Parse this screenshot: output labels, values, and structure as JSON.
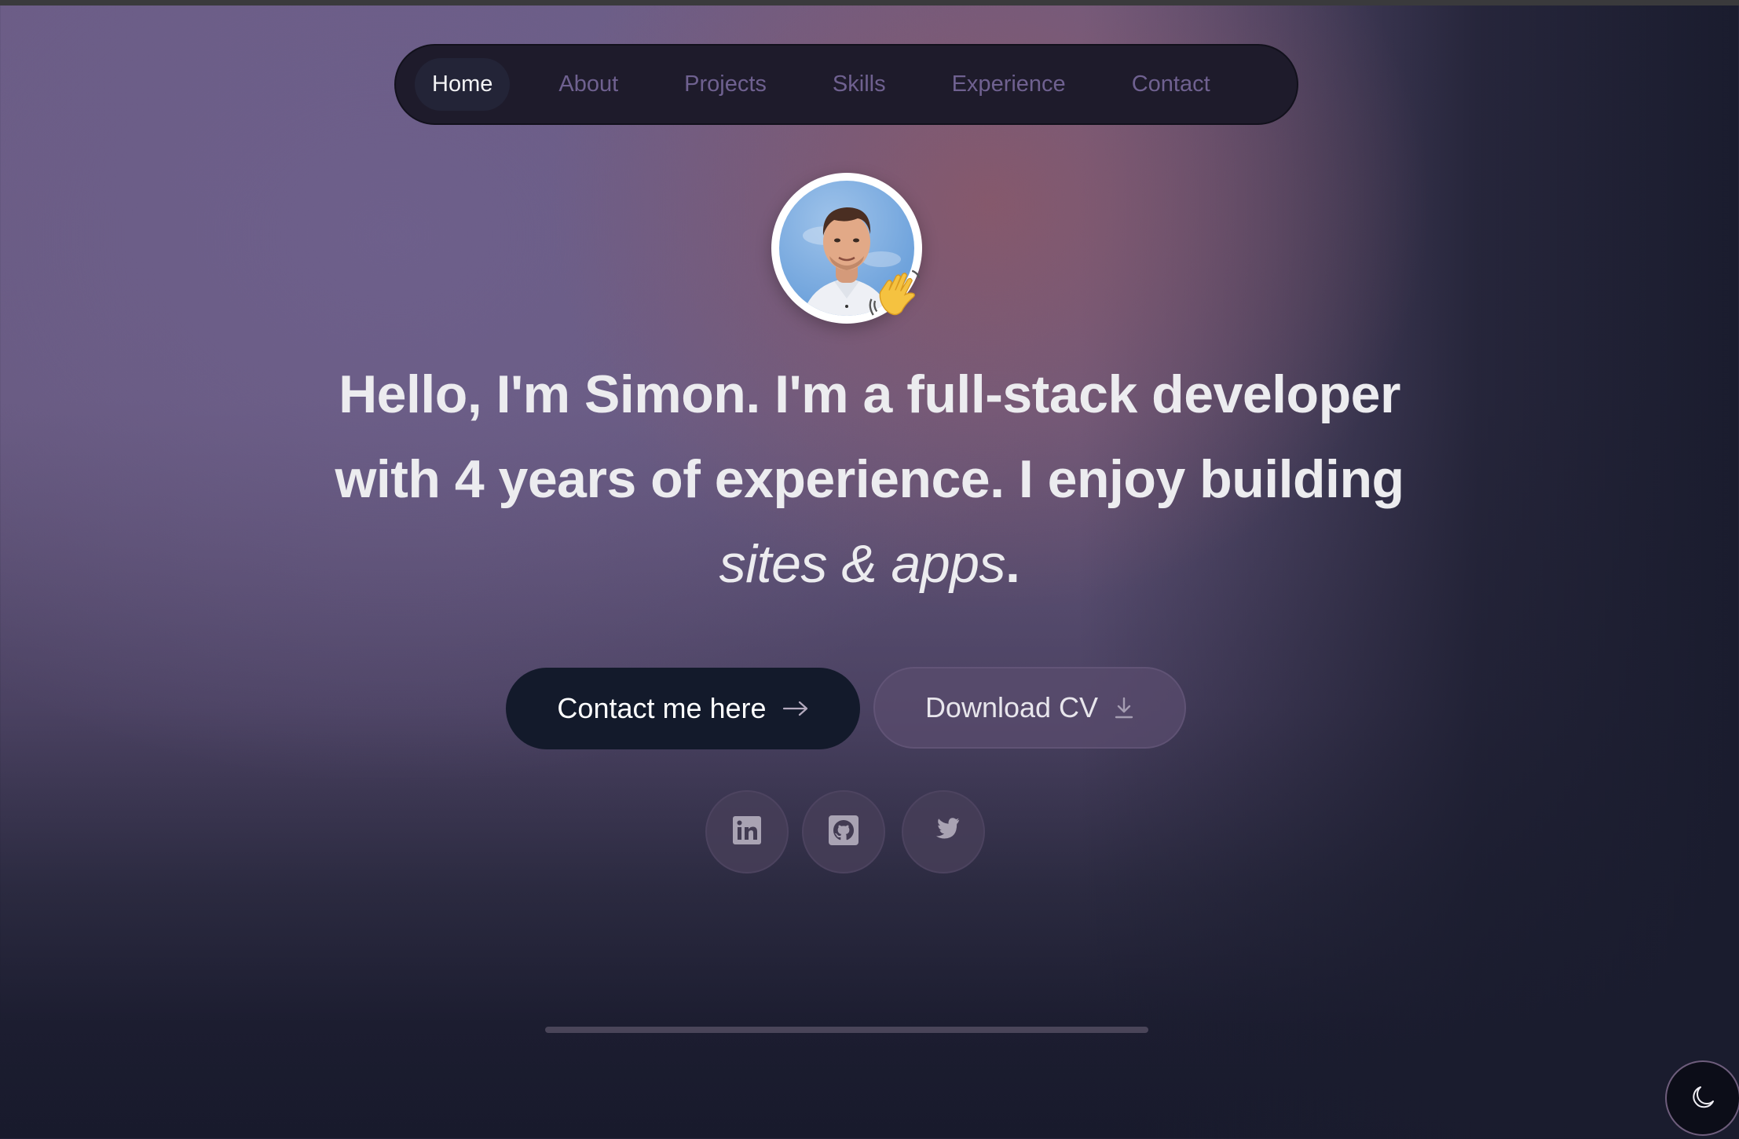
{
  "nav": {
    "items": [
      {
        "label": "Home",
        "active": true
      },
      {
        "label": "About",
        "active": false
      },
      {
        "label": "Projects",
        "active": false
      },
      {
        "label": "Skills",
        "active": false
      },
      {
        "label": "Experience",
        "active": false
      },
      {
        "label": "Contact",
        "active": false
      }
    ]
  },
  "hero": {
    "avatar_alt": "Simon portrait",
    "wave_emoji": "👋",
    "line1": {
      "bold1": "Hello, I'm Simon.",
      "normal": " I'm a ",
      "bold2": "full-stack developer"
    },
    "line2": {
      "normal1": "with ",
      "bold": "4 years",
      "normal2": " of experience. I enjoy building"
    },
    "line3": {
      "italic": "sites & apps",
      "tail": "."
    }
  },
  "actions": {
    "contact_label": "Contact me here",
    "contact_icon": "arrow-right-icon",
    "cv_label": "Download CV",
    "cv_icon": "download-icon"
  },
  "socials": [
    {
      "name": "LinkedIn",
      "icon": "linkedin-icon"
    },
    {
      "name": "GitHub",
      "icon": "github-icon"
    },
    {
      "name": "Twitter",
      "icon": "twitter-icon"
    }
  ],
  "theme_toggle": {
    "icon": "moon-icon",
    "mode": "dark"
  },
  "colors": {
    "nav_bg": "#1e1b2b",
    "nav_active_bg": "#232437",
    "nav_text": "#6f6190",
    "nav_text_active": "#f3f3f5",
    "primary_button": "#131a2b",
    "heading_text": "#ececef",
    "social_icon": "#a9a3b3"
  }
}
